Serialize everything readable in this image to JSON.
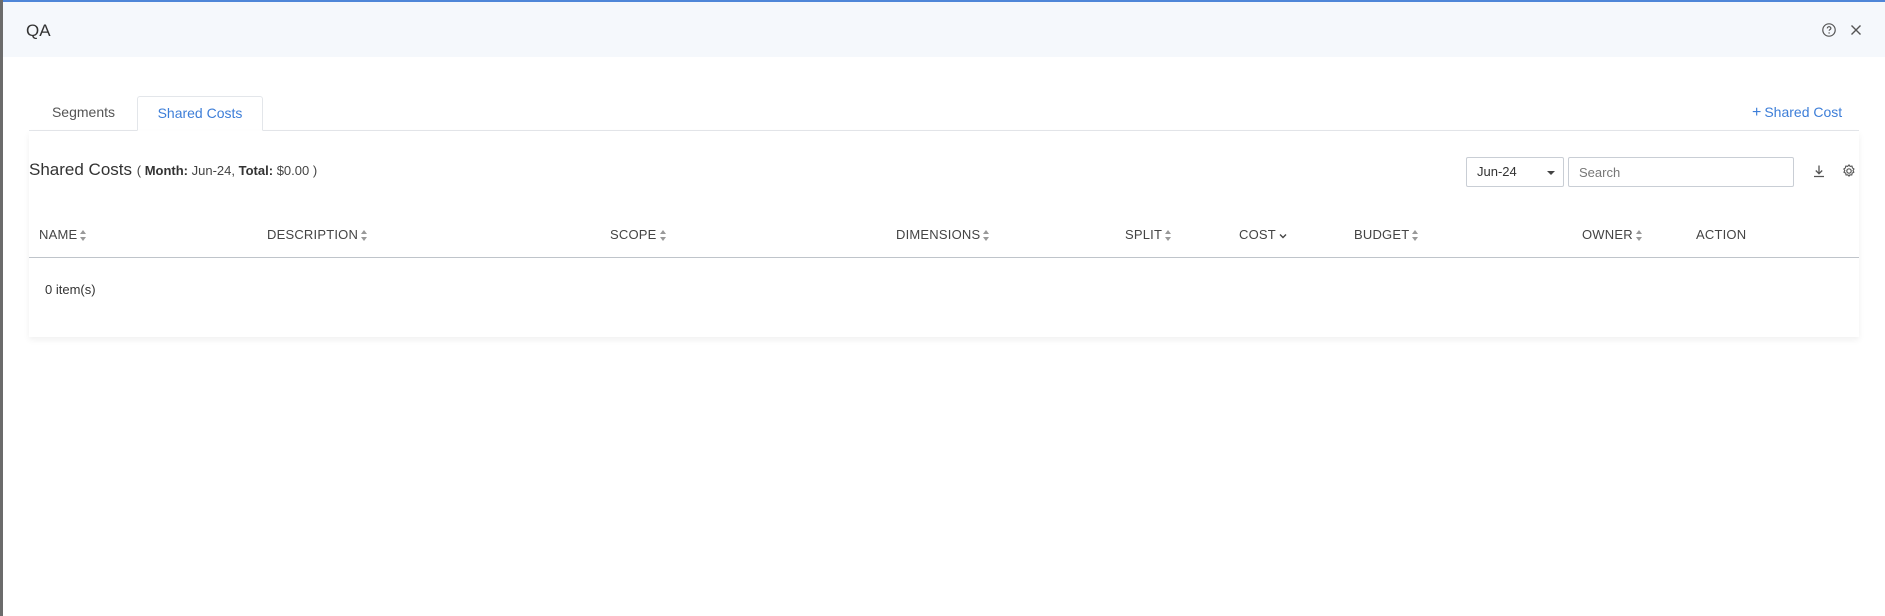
{
  "header": {
    "title": "QA"
  },
  "tabs": [
    {
      "label": "Segments",
      "active": false
    },
    {
      "label": "Shared Costs",
      "active": true
    }
  ],
  "actions": {
    "add_shared_cost": "Shared Cost"
  },
  "panel": {
    "title": "Shared Costs",
    "open_paren": "(",
    "month_key": "Month:",
    "month_value": "Jun-24,",
    "total_key": "Total:",
    "total_value": "$0.00",
    "close_paren": ")"
  },
  "controls": {
    "month_selected": "Jun-24",
    "search_placeholder": "Search"
  },
  "table": {
    "columns": [
      "NAME",
      "DESCRIPTION",
      "SCOPE",
      "DIMENSIONS",
      "SPLIT",
      "COST",
      "BUDGET",
      "OWNER",
      "ACTION"
    ],
    "rows": [],
    "footer": "0 item(s)"
  },
  "colors": {
    "accent": "#3d7ed8",
    "header_bg": "#f5f8fc"
  },
  "icons": {
    "help": "question-circle-icon",
    "close": "close-icon",
    "download": "download-icon",
    "settings": "gear-icon",
    "plus": "plus-icon"
  }
}
